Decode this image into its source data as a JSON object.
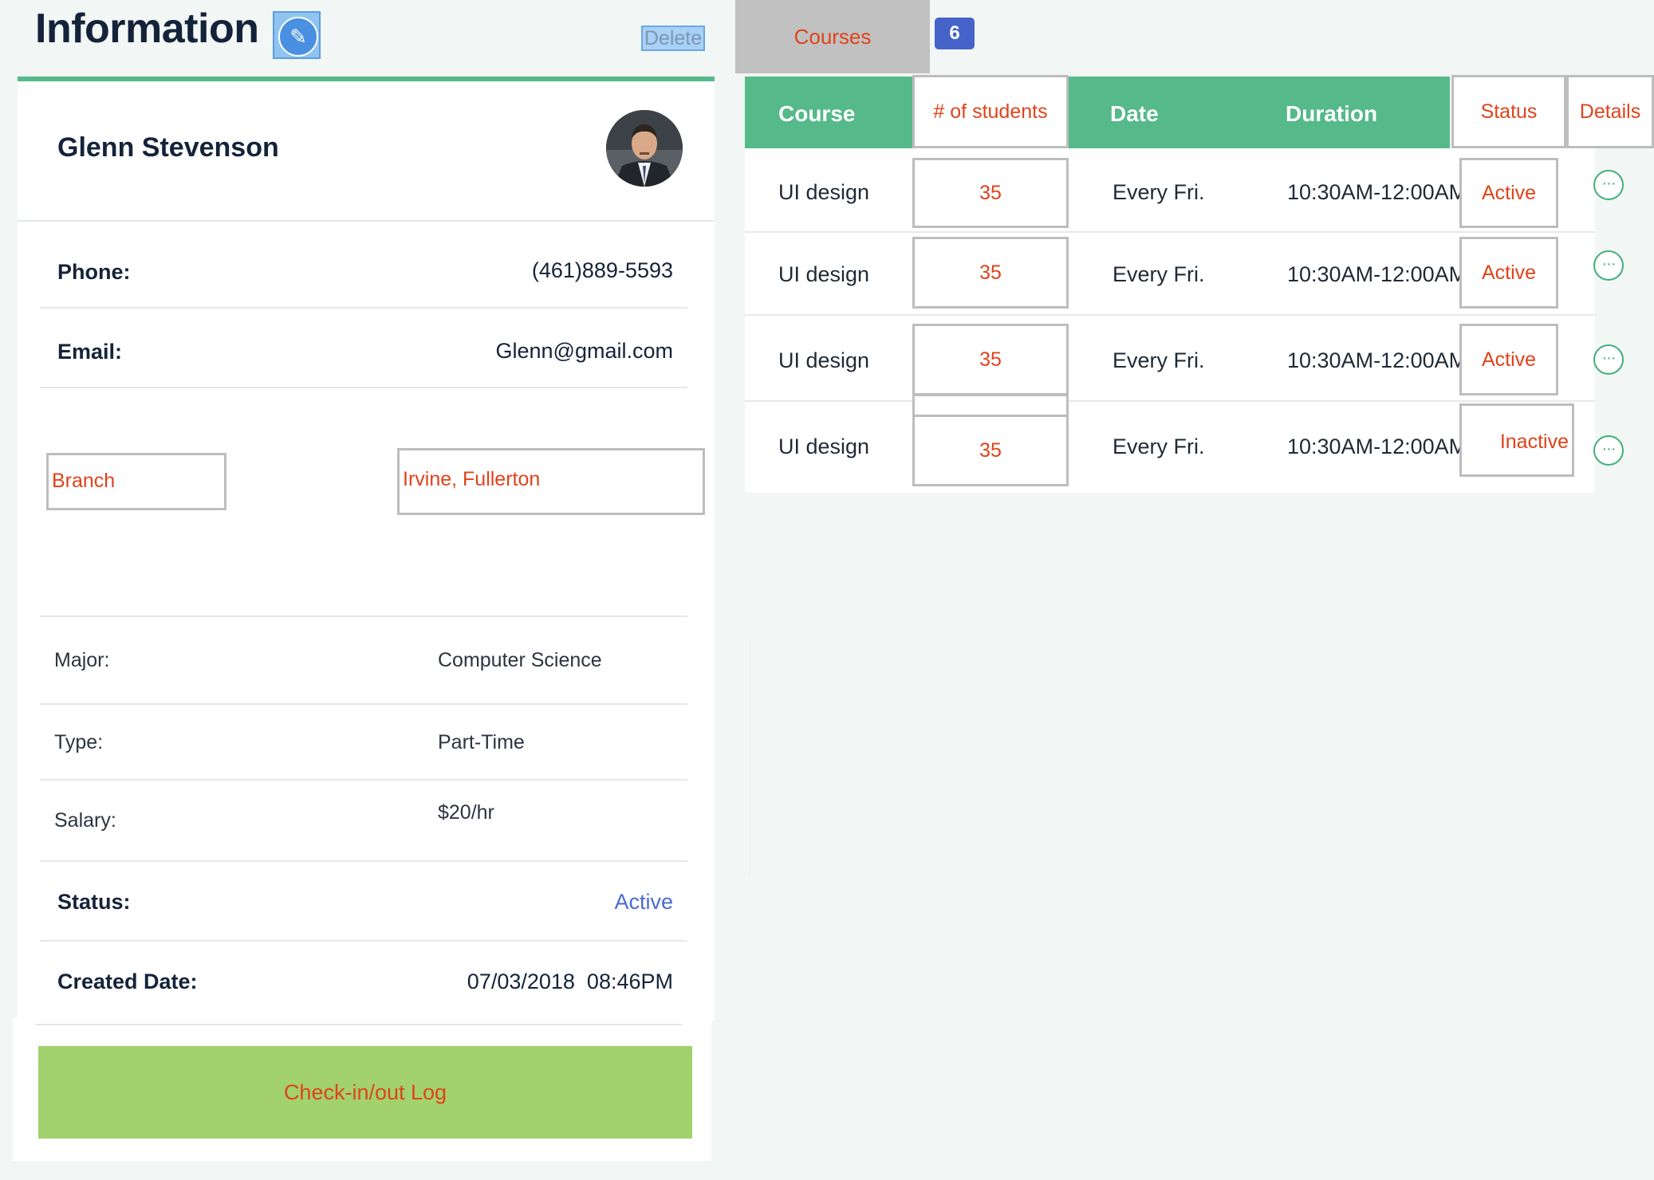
{
  "header": {
    "title": "Information",
    "edit_icon": "pencil-icon",
    "delete_label": "Delete"
  },
  "profile": {
    "name": "Glenn Stevenson",
    "phone_label": "Phone:",
    "phone_value": "(461)889-5593",
    "email_label": "Email:",
    "email_value": "Glenn@gmail.com",
    "branch_label": "Branch",
    "branch_value": "Irvine, Fullerton",
    "major_label": "Major:",
    "major_value": "Computer Science",
    "type_label": "Type:",
    "type_value": "Part-Time",
    "salary_label": "Salary:",
    "salary_value": "$20/hr",
    "status_label": "Status:",
    "status_value": "Active",
    "created_label": "Created Date:",
    "created_value": "07/03/2018  08:46PM",
    "checkin_label": "Check-in/out Log"
  },
  "courses": {
    "tab_label": "Courses",
    "count": "6",
    "columns": {
      "course": "Course",
      "students": "# of students",
      "date": "Date",
      "duration": "Duration",
      "status": "Status",
      "details": "Details"
    },
    "rows": [
      {
        "course": "UI design",
        "students": "35",
        "date": "Every Fri.",
        "duration": "10:30AM-12:00AM",
        "status": "Active",
        "details_icon": "more-dots-icon"
      },
      {
        "course": "UI design",
        "students": "35",
        "date": "Every Fri.",
        "duration": "10:30AM-12:00AM",
        "status": "Active",
        "details_icon": "more-dots-icon"
      },
      {
        "course": "UI design",
        "students": "35",
        "date": "Every Fri.",
        "duration": "10:30AM-12:00AM",
        "status": "Active",
        "details_icon": "more-dots-icon"
      },
      {
        "course": "UI design",
        "students": "35",
        "date": "Every Fri.",
        "duration": "10:30AM-12:00AM",
        "status": "Inactive",
        "details_icon": "more-dots-icon"
      }
    ]
  },
  "colors": {
    "accent_green": "#55b98a",
    "checkin_green": "#a2d16e",
    "badge_blue": "#4563c9",
    "annotation_red": "#e0431a"
  }
}
